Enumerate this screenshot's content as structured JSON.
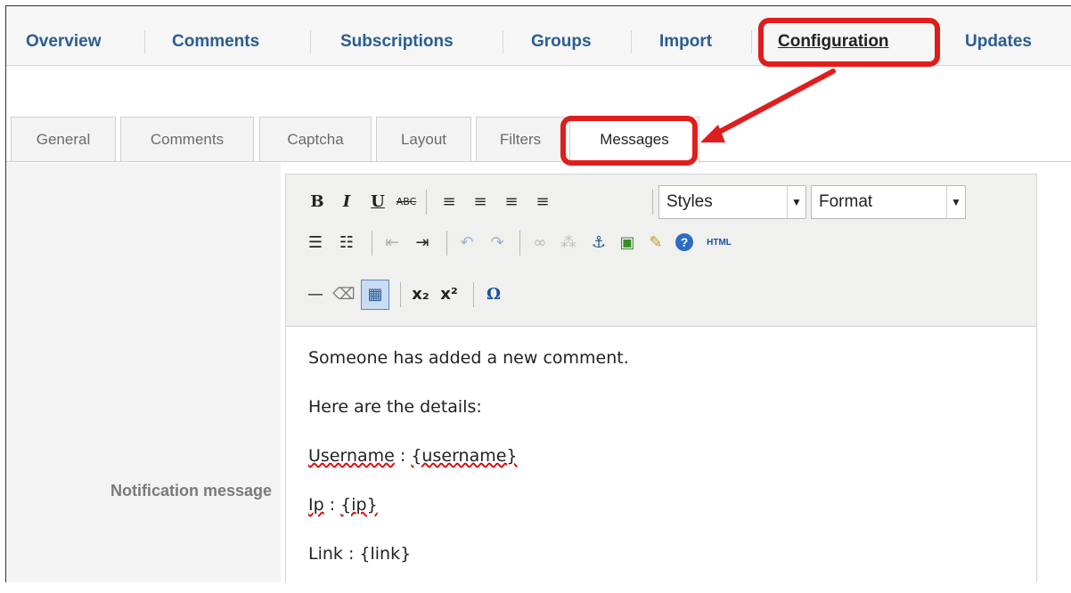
{
  "top_nav": {
    "items": [
      "Overview",
      "Comments",
      "Subscriptions",
      "Groups",
      "Import",
      "Configuration",
      "Updates"
    ],
    "active": "Configuration"
  },
  "sub_tabs": {
    "items": [
      "General",
      "Comments",
      "Captcha",
      "Layout",
      "Filters",
      "Messages"
    ],
    "active": "Messages"
  },
  "form": {
    "field_label": "Notification message"
  },
  "editor": {
    "styles_select": "Styles",
    "format_select": "Format",
    "toolbar_rows": [
      [
        "bold-icon",
        "italic-icon",
        "underline-icon",
        "strikethrough-icon",
        "align-left-icon",
        "align-center-icon",
        "align-right-icon",
        "align-justify-icon"
      ],
      [
        "bullet-list-icon",
        "numbered-list-icon",
        "outdent-icon",
        "indent-icon",
        "undo-icon",
        "redo-icon",
        "link-icon",
        "unlink-icon",
        "anchor-icon",
        "image-icon",
        "cleanup-icon",
        "help-icon",
        "html-icon"
      ],
      [
        "horizontal-rule-icon",
        "eraser-icon",
        "table-icon",
        "subscript-icon",
        "superscript-icon",
        "special-char-icon"
      ]
    ],
    "html_label": "HTML",
    "content": [
      "Someone has added a new comment.",
      "Here are the details:",
      "Username : {username}",
      "Ip : {ip}",
      "Link : {link}"
    ]
  },
  "colors": {
    "accent": "#2a5d91",
    "highlight": "#e01d1d"
  }
}
